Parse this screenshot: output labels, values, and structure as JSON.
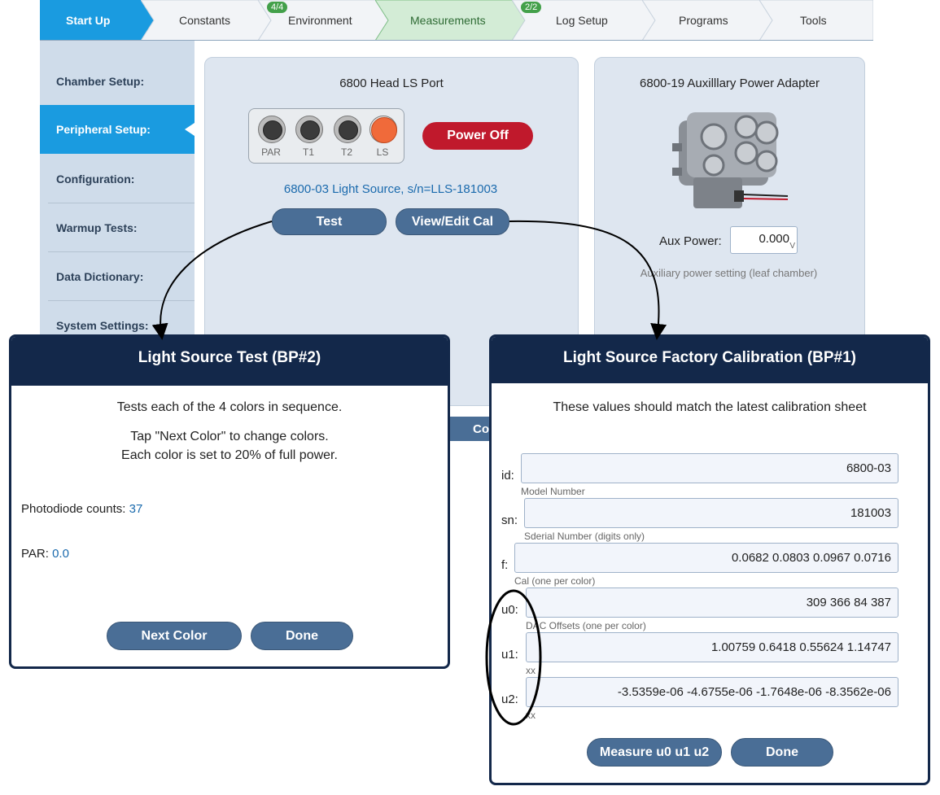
{
  "nav": {
    "tabs": [
      {
        "label": "Start Up",
        "badge": ""
      },
      {
        "label": "Constants",
        "badge": ""
      },
      {
        "label": "Environment",
        "badge": "4/4"
      },
      {
        "label": "Measurements",
        "badge": ""
      },
      {
        "label": "Log Setup",
        "badge": "2/2"
      },
      {
        "label": "Programs",
        "badge": ""
      },
      {
        "label": "Tools",
        "badge": ""
      }
    ]
  },
  "sidebar": {
    "items": [
      {
        "label": "Chamber Setup:"
      },
      {
        "label": "Peripheral Setup:"
      },
      {
        "label": "Configuration:"
      },
      {
        "label": "Warmup Tests:"
      },
      {
        "label": "Data Dictionary:"
      },
      {
        "label": "System Settings:"
      }
    ]
  },
  "head_panel": {
    "title": "6800 Head LS Port",
    "ports": [
      "PAR",
      "T1",
      "T2",
      "LS"
    ],
    "power_button": "Power Off",
    "device_link": "6800-03 Light Source, s/n=LLS-181003",
    "test_button": "Test",
    "cal_button": "View/Edit Cal"
  },
  "aux_panel": {
    "title": "6800-19 Auxilllary Power Adapter",
    "aux_label": "Aux Power:",
    "aux_value": "0.000",
    "aux_unit": "V",
    "aux_help": "Auxiliary power setting (leaf chamber)"
  },
  "hidden_button_fragment": "Co",
  "test_dialog": {
    "title": "Light Source Test (BP#2)",
    "line1": "Tests each of the 4 colors in sequence.",
    "line2": "Tap \"Next Color\" to change colors.",
    "line3": "Each color is set to 20% of full power.",
    "photodiode_label": "Photodiode counts:",
    "photodiode_value": "37",
    "par_label": "PAR:",
    "par_value": "0.0",
    "next_button": "Next Color",
    "done_button": "Done"
  },
  "cal_dialog": {
    "title": "Light Source Factory Calibration (BP#1)",
    "subtitle": "These values should match the latest calibration sheet",
    "fields": [
      {
        "label": "id:",
        "value": "6800-03",
        "help": "Model Number"
      },
      {
        "label": "sn:",
        "value": "181003",
        "help": "Sderial Number (digits only)"
      },
      {
        "label": "f:",
        "value": "0.0682 0.0803 0.0967 0.0716",
        "help": "Cal (one per color)"
      },
      {
        "label": "u0:",
        "value": "309 366 84 387",
        "help": "DAC Offsets (one per color)"
      },
      {
        "label": "u1:",
        "value": "1.00759 0.6418 0.55624 1.14747",
        "help": "xx"
      },
      {
        "label": "u2:",
        "value": "-3.5359e-06 -4.6755e-06 -1.7648e-06 -8.3562e-06",
        "help": "xx"
      }
    ],
    "measure_button": "Measure u0 u1 u2",
    "done_button": "Done"
  },
  "colors": {
    "tab_active": "#1a9be0",
    "tab_selected": "#d3ecd6",
    "tab_default": "#f2f4f7",
    "sidebar_bg": "#cfdcea",
    "dialog_header": "#13284a",
    "button": "#4a6e96",
    "power_off": "#c0192c",
    "badge": "#43a04a"
  }
}
